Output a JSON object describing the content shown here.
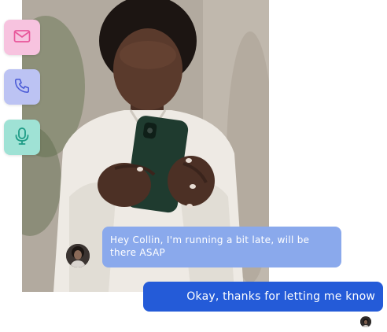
{
  "actions": {
    "mail_icon": "envelope-icon",
    "phone_icon": "phone-icon",
    "mic_icon": "microphone-icon"
  },
  "chat": {
    "incoming_message": "Hey Collin, I'm running a bit late, will be there ASAP",
    "outgoing_message": "Okay, thanks for letting me know"
  },
  "colors": {
    "mail_bg": "#f7c3df",
    "phone_bg": "#bcc3f3",
    "mic_bg": "#9fe2d5",
    "incoming_bubble": "#8aa9ec",
    "outgoing_bubble": "#245bd8"
  }
}
